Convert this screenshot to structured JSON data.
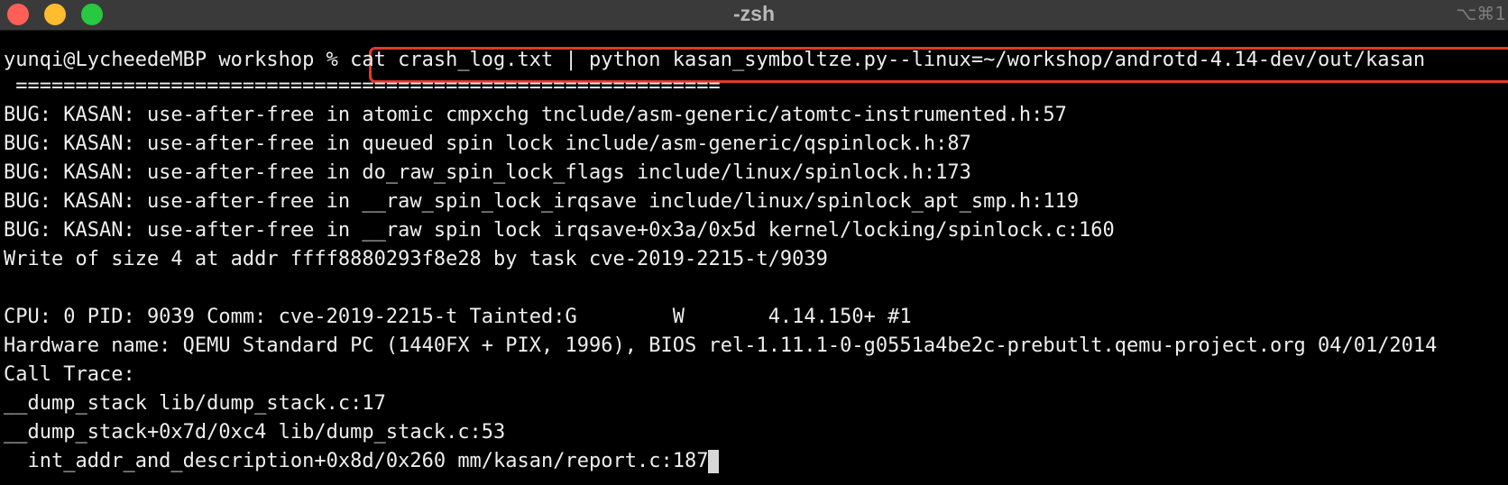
{
  "window": {
    "title": "-zsh",
    "shortcut_hint": "⌥⌘1"
  },
  "terminal": {
    "prompt": "yunqi@LycheedeMBP workshop % ",
    "command": "cat crash_log.txt | python kasan_symboltze.py--linux=~/workshop/androtd-4.14-dev/out/kasan",
    "lines": [
      " ===========================================================",
      "BUG: KASAN: use-after-free in atomic cmpxchg tnclude/asm-generic/atomtc-instrumented.h:57",
      "BUG: KASAN: use-after-free in queued spin lock include/asm-generic/qspinlock.h:87",
      "BUG: KASAN: use-after-free in do_raw_spin_lock_flags include/linux/spinlock.h:173",
      "BUG: KASAN: use-after-free in __raw_spin_lock_irqsave include/linux/spinlock_apt_smp.h:119",
      "BUG: KASAN: use-after-free in __raw spin lock irqsave+0x3a/0x5d kernel/locking/spinlock.c:160",
      "Write of size 4 at addr ffff8880293f8e28 by task cve-2019-2215-t/9039",
      "",
      "CPU: 0 PID: 9039 Comm: cve-2019-2215-t Tainted:G        W       4.14.150+ #1",
      "Hardware name: QEMU Standard PC (1440FX + PIX, 1996), BIOS rel-1.11.1-0-g0551a4be2c-prebutlt.qemu-project.org 04/01/2014",
      "Call Trace:",
      "__dump_stack lib/dump_stack.c:17",
      "__dump_stack+0x7d/0xc4 lib/dump_stack.c:53",
      "  int_addr_and_description+0x8d/0x260 mm/kasan/report.c:187"
    ]
  },
  "colors": {
    "background": "#000000",
    "text": "#eeeeee",
    "titlebar": "#3a3a3a",
    "highlight": "#e5372b",
    "close": "#fe5f57",
    "minimize": "#febc2e",
    "zoom": "#28c840"
  }
}
